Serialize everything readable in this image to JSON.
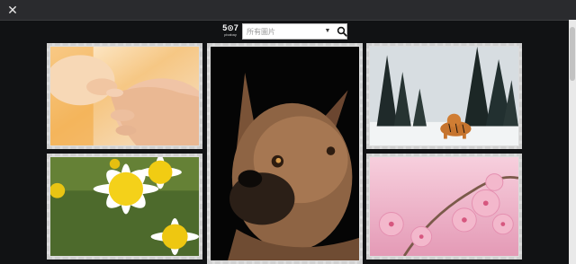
{
  "topbar": {
    "close_glyph": "✕"
  },
  "header": {
    "logo_mark": "5⊙7",
    "logo_text": "pixabay",
    "search_placeholder": "所有圖片",
    "dropdown_glyph": "▼"
  },
  "gallery": {
    "items": [
      {
        "icon": "baby-hand-photo",
        "accent": "#f2b25a"
      },
      {
        "icon": "dog-portrait-photo",
        "accent": "#9a6b45"
      },
      {
        "icon": "tiger-snow-photo",
        "accent": "#e6ecef"
      },
      {
        "icon": "daisy-flowers-photo",
        "accent": "#f1d21a"
      },
      {
        "icon": "cherry-blossom-photo",
        "accent": "#e6a4bf"
      }
    ]
  }
}
